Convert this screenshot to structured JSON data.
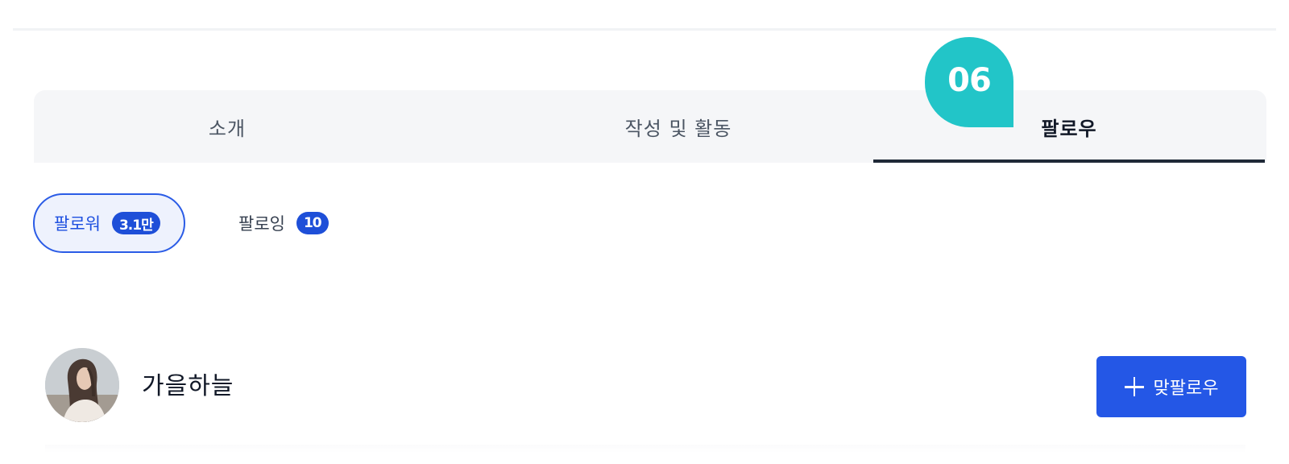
{
  "step_badge": "06",
  "tabs": [
    {
      "label": "소개",
      "active": false
    },
    {
      "label": "작성 및 활동",
      "active": false
    },
    {
      "label": "팔로우",
      "active": true
    }
  ],
  "sub_tabs": [
    {
      "label": "팔로워",
      "count": "3.1만",
      "active": true
    },
    {
      "label": "팔로잉",
      "count": "10",
      "active": false
    }
  ],
  "users": [
    {
      "name": "가을하늘",
      "button_label": "맞팔로우",
      "button_icon": "plus-icon"
    }
  ],
  "colors": {
    "accent": "#2457e6",
    "step_badge": "#22c5c8",
    "tab_bar_bg": "#f5f6f8"
  }
}
